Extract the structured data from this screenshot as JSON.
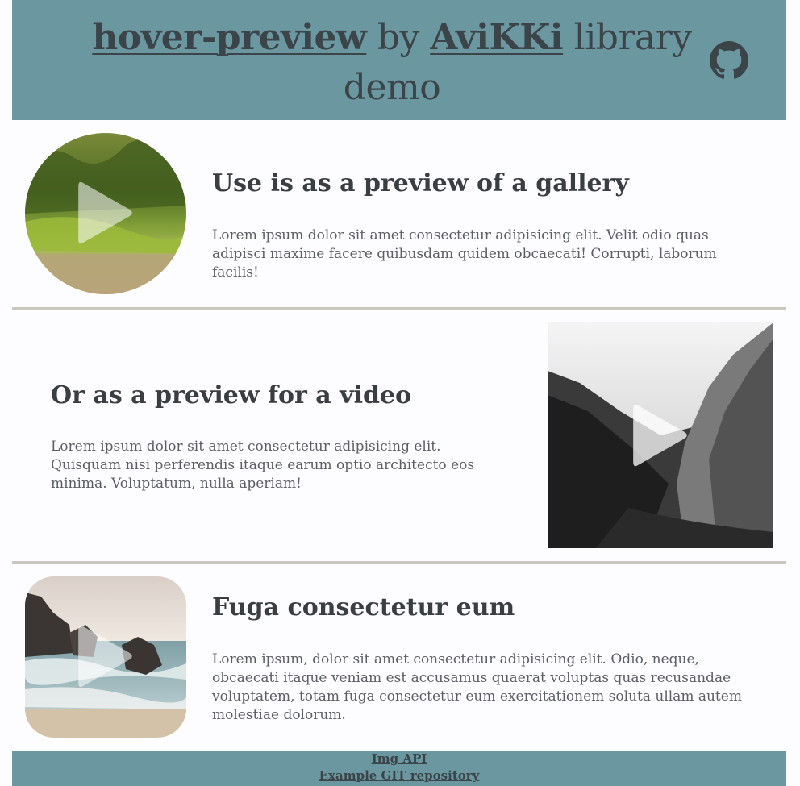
{
  "header": {
    "title_part1": "hover-preview",
    "title_by": " by ",
    "title_author": "AviKKi",
    "title_rest": " library demo",
    "github_icon": "github-icon"
  },
  "sections": [
    {
      "title": "Use is as a preview of a gallery",
      "text": "Lorem ipsum dolor sit amet consectetur adipisicing elit. Velit odio quas adipisci maxime facere quibusdam quidem obcaecati! Corrupti, laborum facilis!",
      "thumb": "forest-moss-image"
    },
    {
      "title": "Or as a preview for a video",
      "text": "Lorem ipsum dolor sit amet consectetur adipisicing elit. Quisquam nisi perferendis itaque earum optio architecto eos minima. Voluptatum, nulla aperiam!",
      "thumb": "mountain-valley-image"
    },
    {
      "title": "Fuga consectetur eum",
      "text": "Lorem ipsum, dolor sit amet consectetur adipisicing elit. Odio, neque, obcaecati itaque veniam est accusamus quaerat voluptas quas recusandae voluptatem, totam fuga consectetur eum exercitationem soluta ullam autem molestiae dolorum.",
      "thumb": "beach-rocks-image"
    }
  ],
  "footer": {
    "link1": "Img API",
    "link2": "Example GIT repository"
  },
  "colors": {
    "header_bg": "#6b97a1",
    "page_bg": "#fdfcfe",
    "divider": "#c9c8bf",
    "text_dark": "#3b3e41"
  }
}
